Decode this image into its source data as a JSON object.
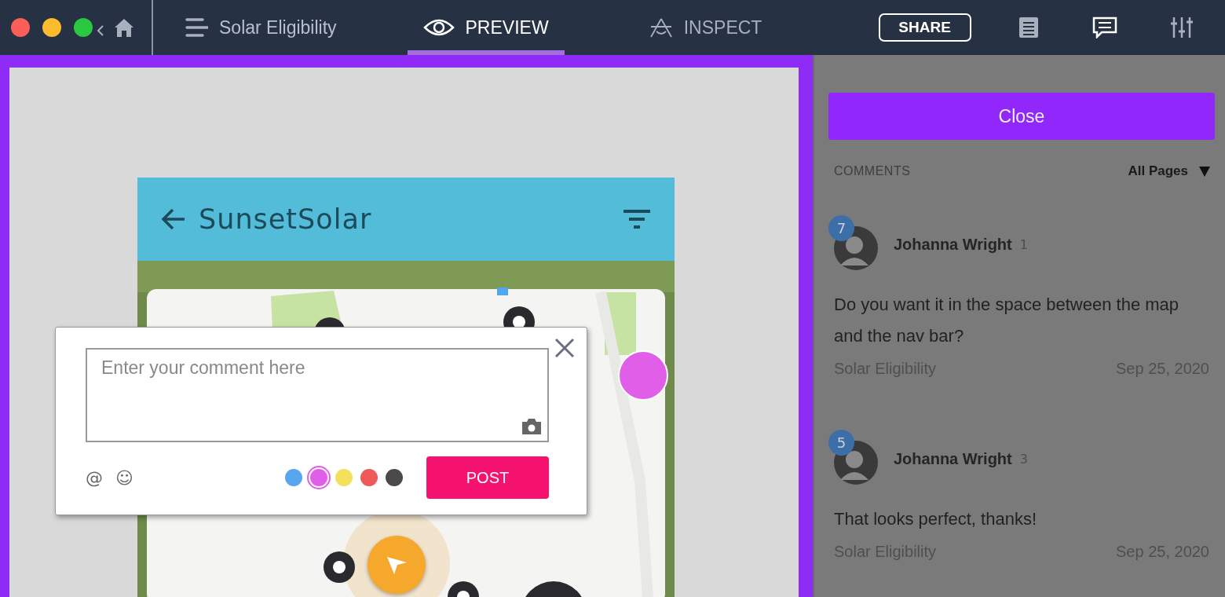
{
  "toolbar": {
    "project_title": "Solar Eligibility",
    "tabs": [
      {
        "label": "PREVIEW",
        "kind": "preview",
        "selected": true
      },
      {
        "label": "INSPECT",
        "kind": "inspect",
        "selected": false
      }
    ],
    "share": "SHARE",
    "comments_active": true
  },
  "phone": {
    "title": "SunsetSolar"
  },
  "comment_popup": {
    "placeholder": "Enter your comment here",
    "mention": "@",
    "emoji": "☺",
    "colors": [
      {
        "color": "#5aa6ee",
        "selected": false
      },
      {
        "color": "#e05ee8",
        "selected": true
      },
      {
        "color": "#f3e15c",
        "selected": false
      },
      {
        "color": "#ee5a5a",
        "selected": false
      },
      {
        "color": "#4a4a4a",
        "selected": false
      }
    ],
    "post": "POST"
  },
  "panel": {
    "close": "Close",
    "heading": "COMMENTS",
    "filter": "All Pages",
    "comments": [
      {
        "badge": "7",
        "author": "Johanna Wright",
        "count": "1",
        "text": "Do you want it in the space between the map and the nav bar?",
        "page": "Solar Eligibility",
        "date": "Sep 25, 2020"
      },
      {
        "badge": "5",
        "author": "Johanna Wright",
        "count": "3",
        "text": "That looks perfect, thanks!",
        "page": "Solar Eligibility",
        "date": "Sep 25, 2020"
      }
    ]
  }
}
